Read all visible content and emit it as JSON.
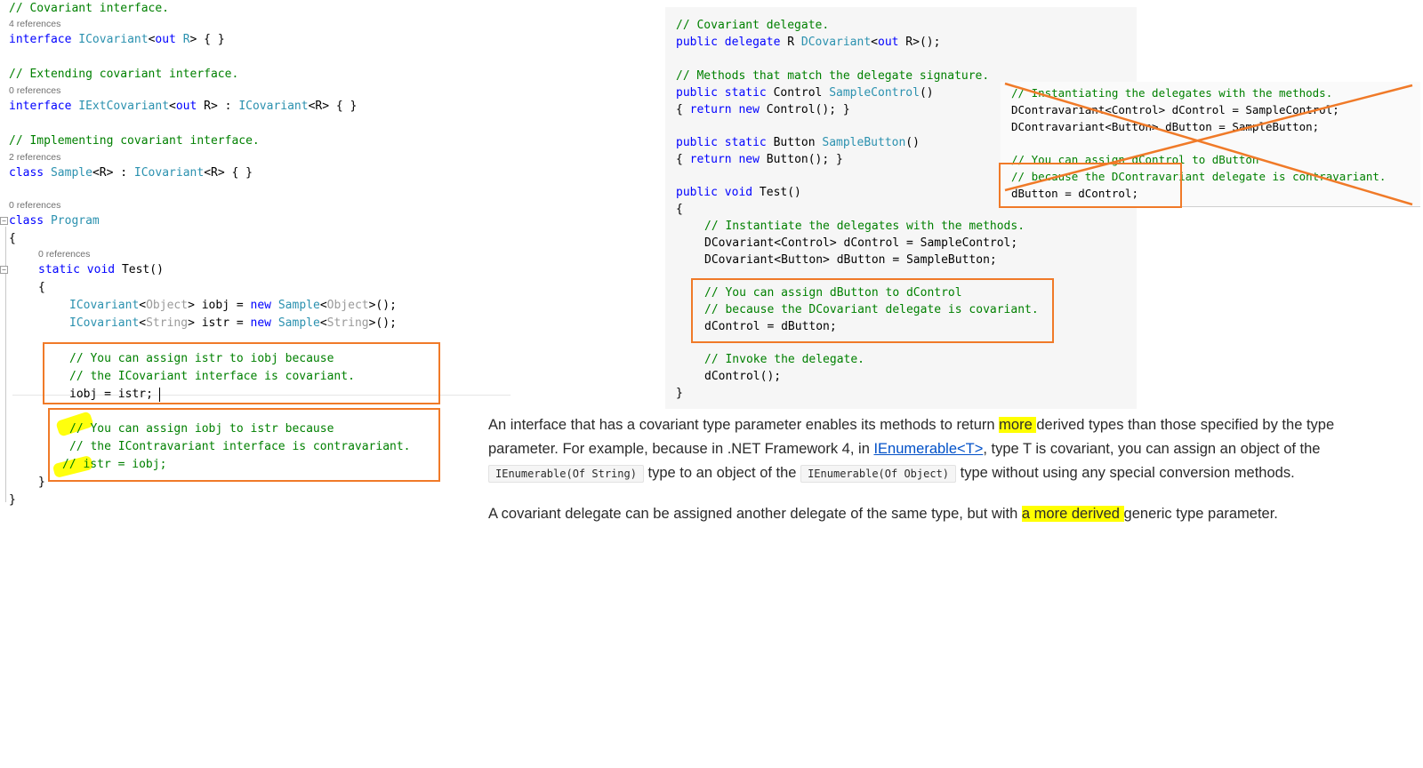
{
  "left_code": {
    "lines": [
      {
        "id": "l1",
        "text": "// Covariant interface."
      },
      {
        "id": "r1",
        "text": "4 references"
      },
      {
        "id": "l2a",
        "text": "interface "
      },
      {
        "id": "l2b",
        "text": "ICovariant"
      },
      {
        "id": "l2c",
        "text": "<"
      },
      {
        "id": "l2d",
        "text": "out "
      },
      {
        "id": "l2e",
        "text": "R"
      },
      {
        "id": "l2f",
        "text": "> { }"
      },
      {
        "id": "l3",
        "text": "// Extending covariant interface."
      },
      {
        "id": "r2",
        "text": "0 references"
      },
      {
        "id": "l4",
        "text": "interface IExtCovariant<out R> : ICovariant<R> { }"
      },
      {
        "id": "l5",
        "text": "// Implementing covariant interface."
      },
      {
        "id": "r3",
        "text": "2 references"
      },
      {
        "id": "l6",
        "text": "class Sample<R> : ICovariant<R> { }"
      },
      {
        "id": "r4",
        "text": "0 references"
      },
      {
        "id": "l7",
        "text": "class Program"
      },
      {
        "id": "l8",
        "text": "{"
      },
      {
        "id": "r5",
        "text": "0 references"
      },
      {
        "id": "l9",
        "text": "static void Test()"
      },
      {
        "id": "l10",
        "text": "{"
      },
      {
        "id": "l11",
        "text": "ICovariant<Object> iobj = new Sample<Object>();"
      },
      {
        "id": "l12",
        "text": "ICovariant<String> istr = new Sample<String>();"
      },
      {
        "id": "l13",
        "text": "// You can assign istr to iobj because"
      },
      {
        "id": "l14",
        "text": "// the ICovariant interface is covariant."
      },
      {
        "id": "l15",
        "text": "iobj = istr;"
      },
      {
        "id": "l16",
        "text": "// You can assign iobj to istr because"
      },
      {
        "id": "l17",
        "text": "// the IContravariant interface is contravariant."
      },
      {
        "id": "l18",
        "text": "// istr = iobj;"
      },
      {
        "id": "l19",
        "text": "}"
      },
      {
        "id": "l20",
        "text": "}"
      }
    ]
  },
  "doc_code": {
    "c1": "// Covariant delegate.",
    "c2": "// Methods that match the delegate signature.",
    "c3": "// Instantiate the delegates with the methods.",
    "c4": "// You can assign dButton to dControl",
    "c5": "// because the DCovariant delegate is covariant.",
    "c6": "// Invoke the delegate.",
    "s1": "dControl = dButton;",
    "s2": "dControl();",
    "open": "{",
    "close": "}"
  },
  "strike_code": {
    "l1": "// Instantiating the delegates with the methods.",
    "l2": "DContravariant<Control> dControl = SampleControl;",
    "l3": "DContravariant<Button> dButton = SampleButton;",
    "l4": "// You can assign dControl to dButton",
    "l5": "// because the DContravariant delegate is contravariant.",
    "l6": "dButton = dControl;"
  },
  "prose": {
    "p1_a": "An interface that has a covariant type parameter enables its methods to return ",
    "p1_hl": "more ",
    "p1_b": "derived types than those specified by the type parameter. For example, because in .NET Framework 4, in ",
    "p1_link": "IEnumerable<T>",
    "p1_c": ", type T is covariant, you can assign an object of the ",
    "p1_code1": "IEnumerable(Of String)",
    "p1_d": " type to an object of the ",
    "p1_code2": "IEnumerable(Of Object)",
    "p1_e": " type without using any special conversion methods.",
    "p2_a": "A covariant delegate can be assigned another delegate of the same type, but with ",
    "p2_hl": "a more derived ",
    "p2_b": "generic type parameter."
  },
  "colors": {
    "comment": "#008000",
    "keyword": "#0000ff",
    "type": "#2b91af",
    "annotation": "#f07a28",
    "highlight": "#ffff00"
  }
}
